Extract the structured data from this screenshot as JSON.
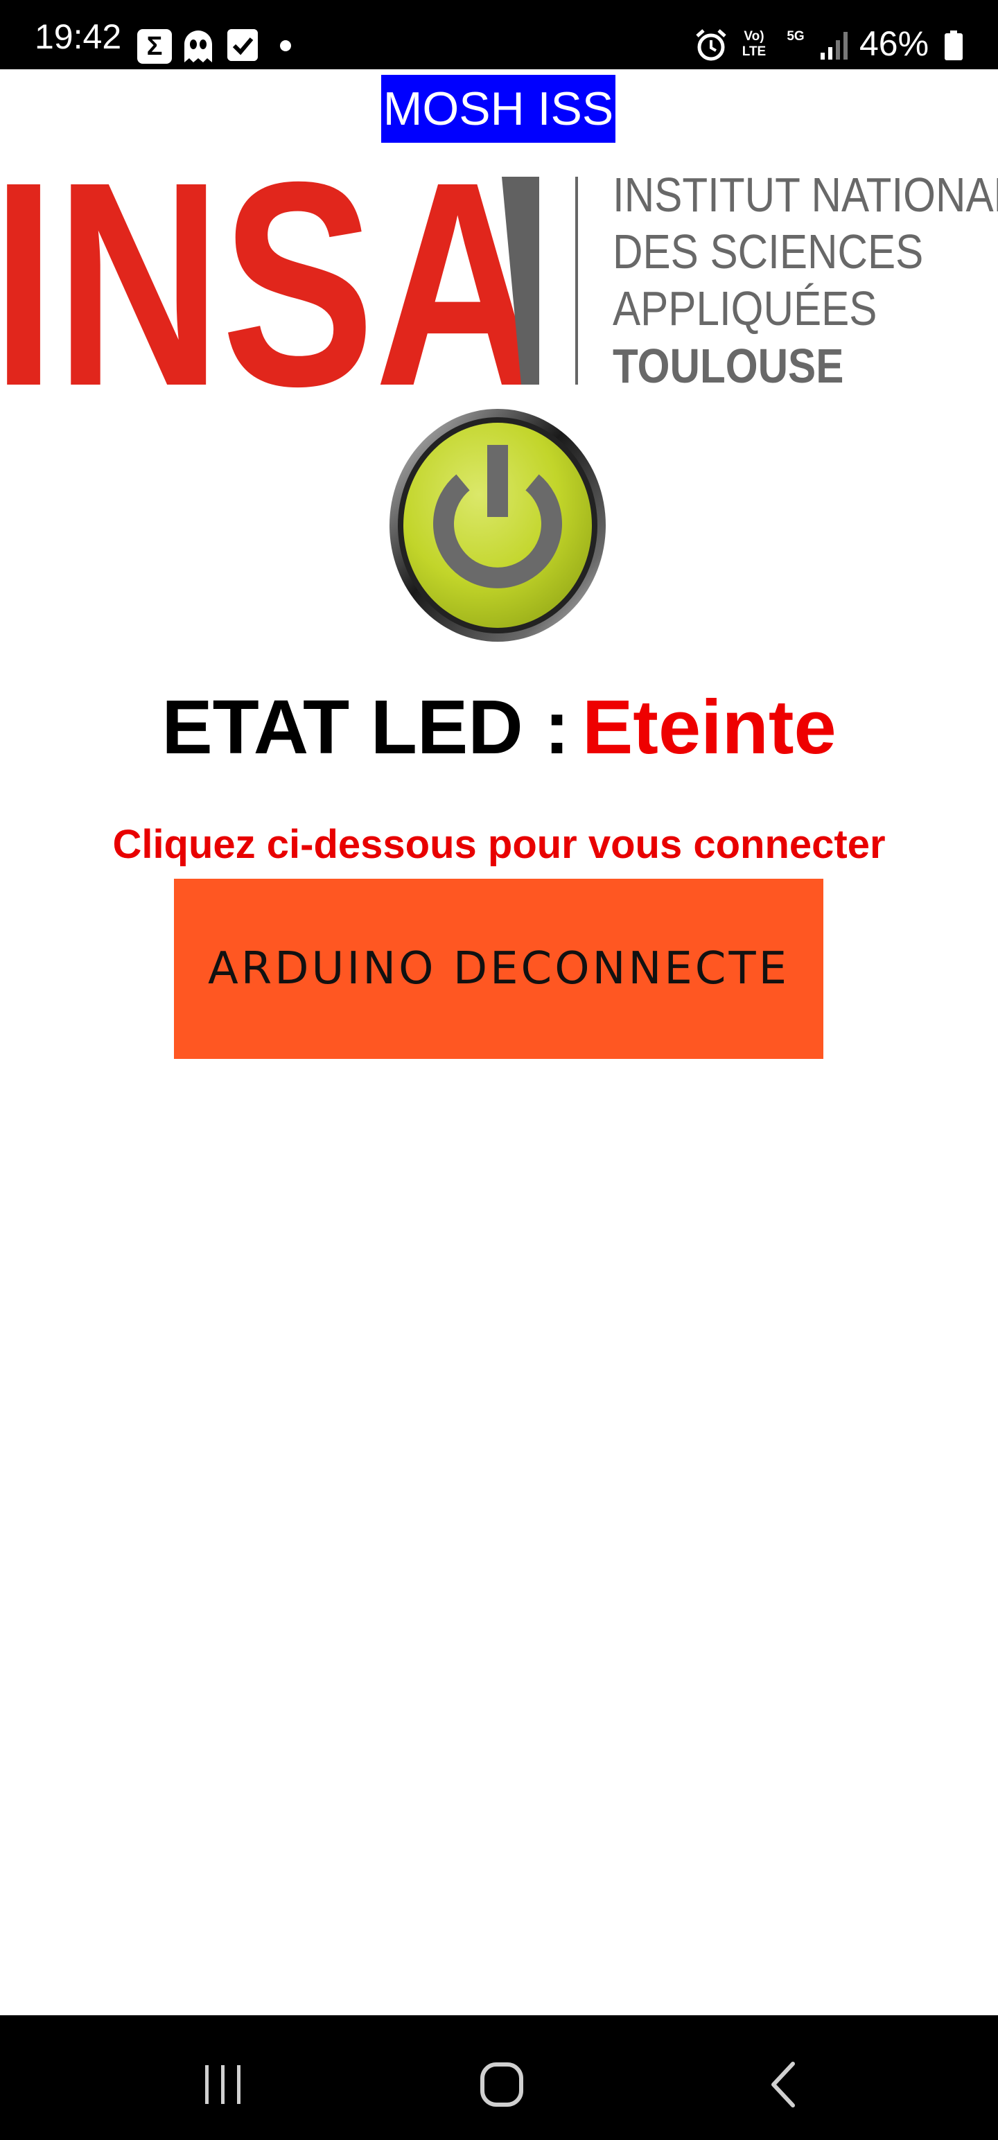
{
  "status_bar": {
    "time": "19:42",
    "notification_icons": [
      "sigma-icon",
      "ghost-icon",
      "checkbox-icon",
      "dot-icon"
    ],
    "system_icons": [
      "alarm-icon",
      "volte-icon",
      "5g-icon",
      "signal-icon",
      "battery-icon"
    ],
    "volte_label": "Vo) LTE",
    "network_label": "5G",
    "battery_percent": "46%",
    "battery_level": 0.46
  },
  "app": {
    "title": "MOSH ISS",
    "title_bg_color": "#0000ff"
  },
  "logo": {
    "brand": "INSA",
    "brand_color": "#e1261c",
    "lines": [
      "INSTITUT NATIONAL",
      "DES SCIENCES",
      "APPLIQUÉES",
      "TOULOUSE"
    ]
  },
  "power_button": {
    "icon": "power-icon",
    "color": "#c5d82a"
  },
  "led": {
    "label": "ETAT LED :",
    "value": "Eteinte",
    "value_color": "#ee0000"
  },
  "connection": {
    "instruction": "Cliquez ci-dessous pour vous connecter",
    "button_label": "ARDUINO DECONNECTE",
    "button_color": "#ff5722"
  },
  "nav_bar": {
    "buttons": [
      "recent-apps-icon",
      "home-icon",
      "back-icon"
    ]
  }
}
